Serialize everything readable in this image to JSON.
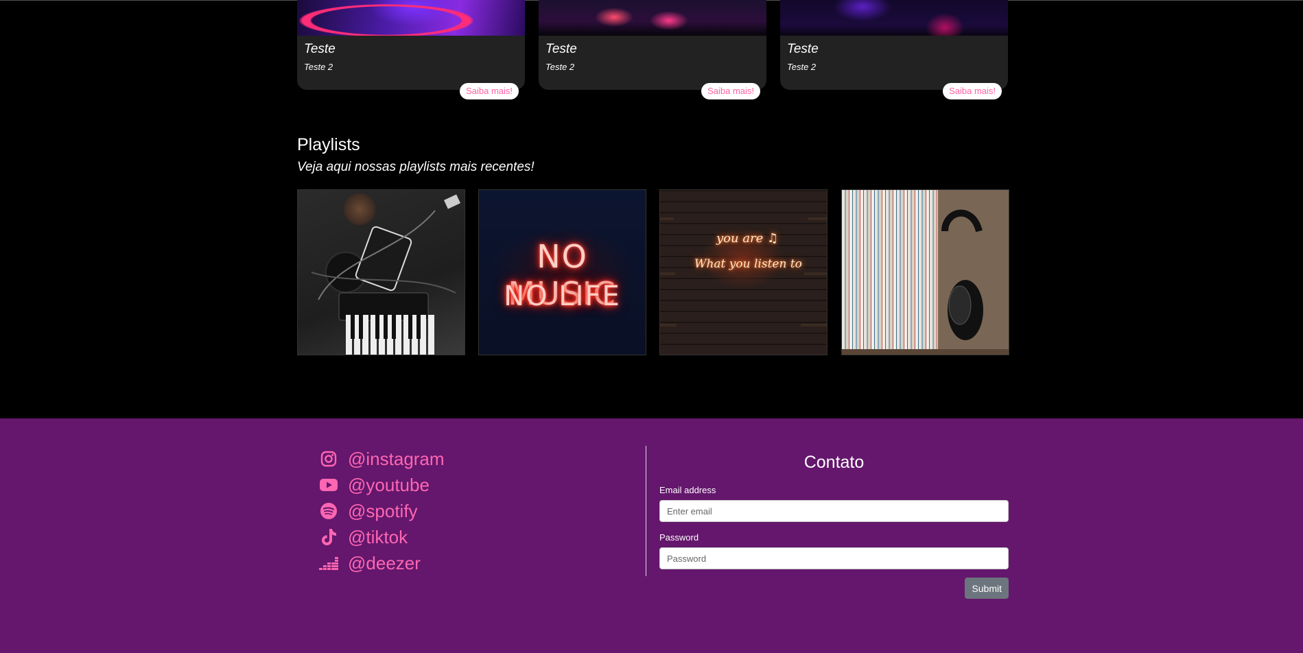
{
  "cards": [
    {
      "title": "Teste",
      "subtitle": "Teste 2",
      "button": "Saiba mais!"
    },
    {
      "title": "Teste",
      "subtitle": "Teste 2",
      "button": "Saiba mais!"
    },
    {
      "title": "Teste",
      "subtitle": "Teste 2",
      "button": "Saiba mais!"
    }
  ],
  "playlists": {
    "title": "Playlists",
    "subtitle": "Veja aqui nossas playlists mais recentes!",
    "neon_line1": "NO MUSIC",
    "neon_line2": "NO LIFE",
    "neon_small1": "you are ♫",
    "neon_small2": "What you listen to"
  },
  "footer": {
    "socials": [
      {
        "icon": "instagram-icon",
        "label": "@instagram"
      },
      {
        "icon": "youtube-icon",
        "label": "@youtube"
      },
      {
        "icon": "spotify-icon",
        "label": "@spotify"
      },
      {
        "icon": "tiktok-icon",
        "label": "@tiktok"
      },
      {
        "icon": "deezer-icon",
        "label": "@deezer"
      }
    ],
    "contact": {
      "title": "Contato",
      "email_label": "Email address",
      "email_placeholder": "Enter email",
      "password_label": "Password",
      "password_placeholder": "Password",
      "submit": "Submit"
    }
  },
  "colors": {
    "background": "#000000",
    "card": "#222222",
    "accent_pink": "#ff66b2",
    "footer_purple": "#64176c",
    "submit_gray": "#6c757d"
  }
}
